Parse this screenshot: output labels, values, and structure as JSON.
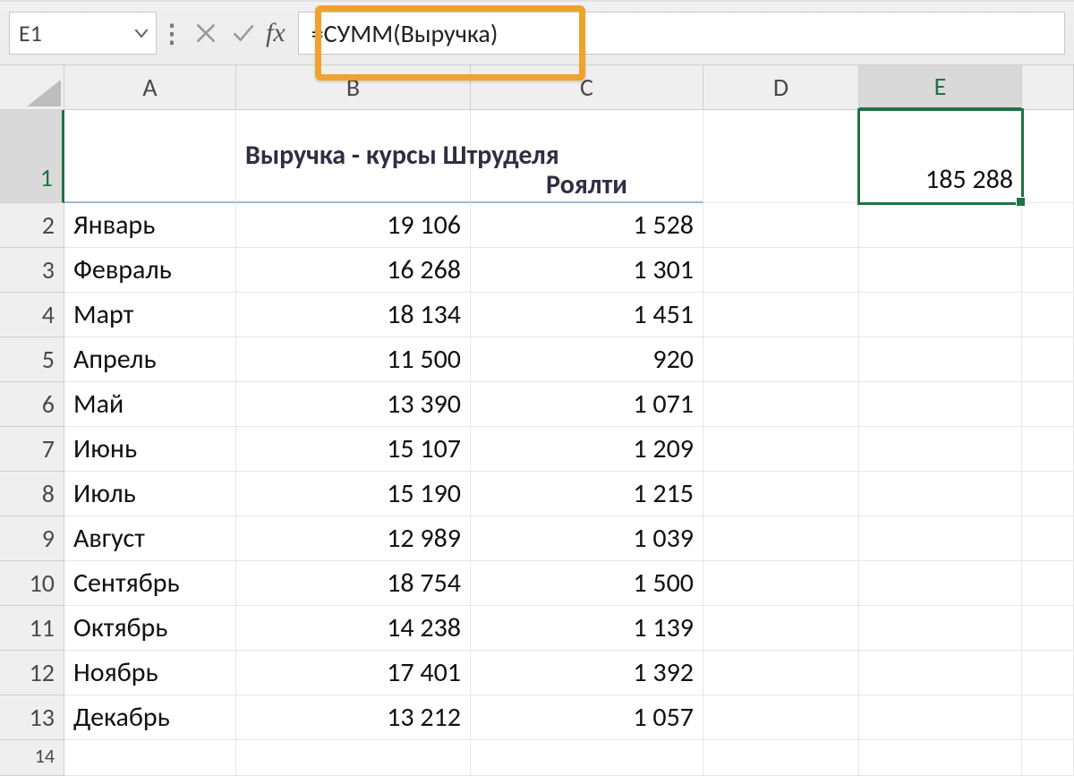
{
  "namebox": {
    "value": "E1"
  },
  "formula": "=СУММ(Выручка)",
  "columns": [
    "A",
    "B",
    "C",
    "D",
    "E"
  ],
  "headers": {
    "B": "Выручка - курсы Штруделя",
    "C": "Роялти"
  },
  "selected_cell": {
    "ref": "E1",
    "value": "185 288"
  },
  "rows": [
    {
      "n": 2,
      "A": "Январь",
      "B": "19 106",
      "C": "1 528"
    },
    {
      "n": 3,
      "A": "Февраль",
      "B": "16 268",
      "C": "1 301"
    },
    {
      "n": 4,
      "A": "Март",
      "B": "18 134",
      "C": "1 451"
    },
    {
      "n": 5,
      "A": "Апрель",
      "B": "11 500",
      "C": "920"
    },
    {
      "n": 6,
      "A": "Май",
      "B": "13 390",
      "C": "1 071"
    },
    {
      "n": 7,
      "A": "Июнь",
      "B": "15 107",
      "C": "1 209"
    },
    {
      "n": 8,
      "A": "Июль",
      "B": "15 190",
      "C": "1 215"
    },
    {
      "n": 9,
      "A": "Август",
      "B": "12 989",
      "C": "1 039"
    },
    {
      "n": 10,
      "A": "Сентябрь",
      "B": "18 754",
      "C": "1 500"
    },
    {
      "n": 11,
      "A": "Октябрь",
      "B": "14 238",
      "C": "1 139"
    },
    {
      "n": 12,
      "A": "Ноябрь",
      "B": "17 401",
      "C": "1 392"
    },
    {
      "n": 13,
      "A": "Декабрь",
      "B": "13 212",
      "C": "1 057"
    }
  ],
  "extra_row": 14,
  "icons": {
    "fx": "fx"
  }
}
